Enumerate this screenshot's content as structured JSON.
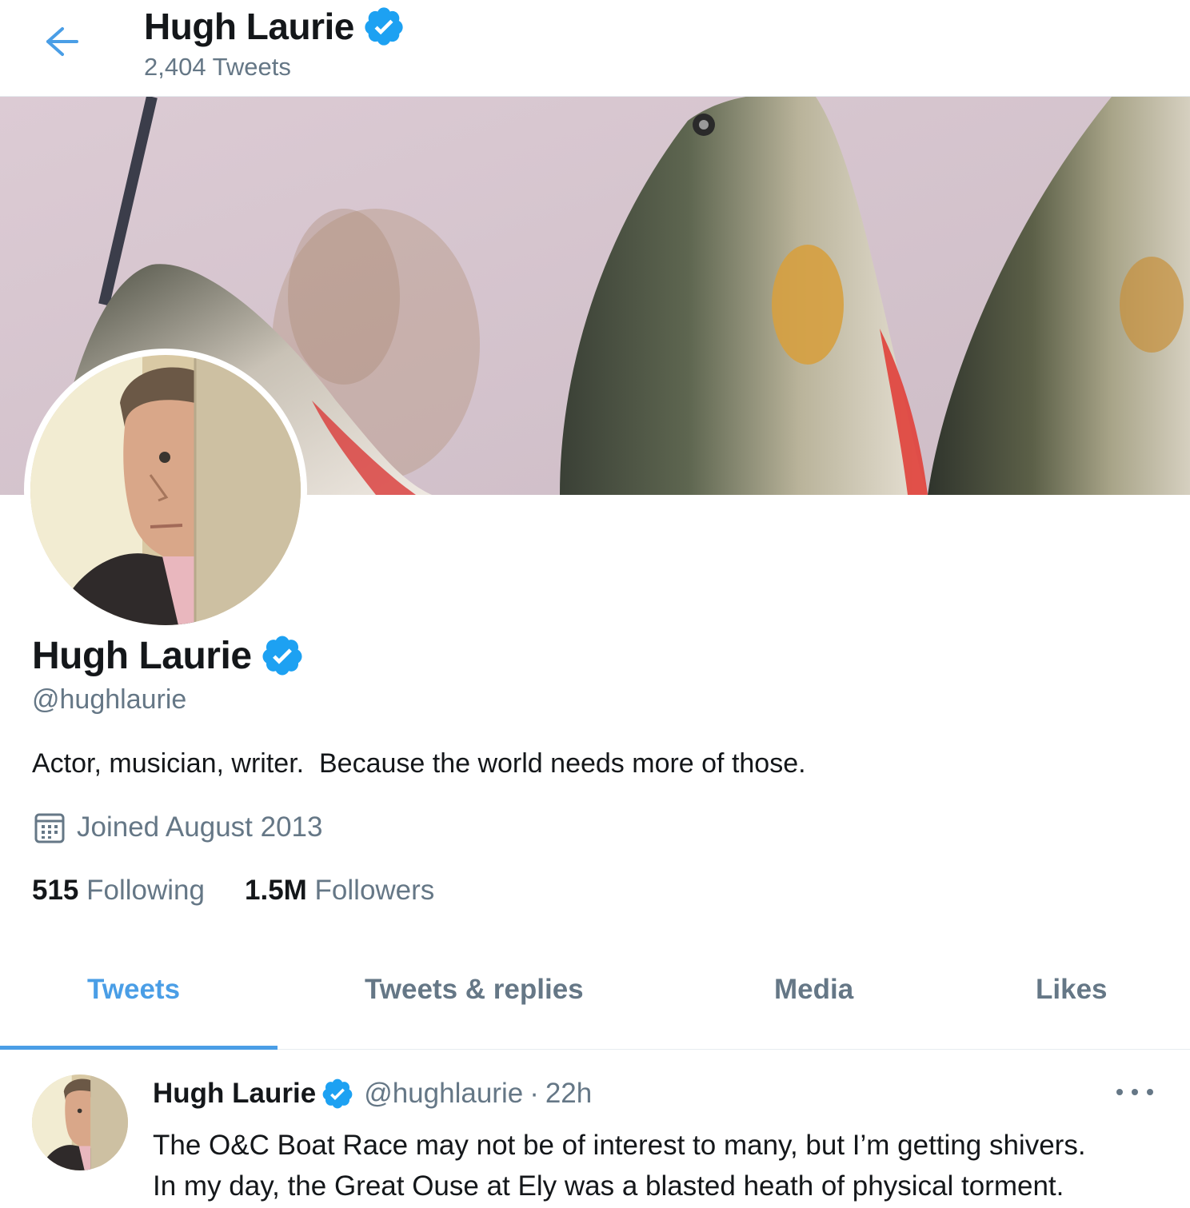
{
  "header": {
    "name": "Hugh Laurie",
    "tweet_count": "2,404 Tweets"
  },
  "profile": {
    "name": "Hugh Laurie",
    "handle": "@hughlaurie",
    "bio": "Actor, musician, writer.  Because the world needs more of those.",
    "joined": "Joined August 2013",
    "following_count": "515",
    "following_label": "Following",
    "followers_count": "1.5M",
    "followers_label": "Followers"
  },
  "tabs": [
    {
      "label": "Tweets",
      "active": true
    },
    {
      "label": "Tweets & replies",
      "active": false
    },
    {
      "label": "Media",
      "active": false
    },
    {
      "label": "Likes",
      "active": false
    }
  ],
  "tweet": {
    "name": "Hugh Laurie",
    "handle": "@hughlaurie",
    "separator": "·",
    "time": "22h",
    "text_line1": "The O&C Boat Race may not be of interest to many, but I’m getting shivers.",
    "text_line2": "In my day, the Great Ouse at Ely was a blasted heath of physical torment."
  },
  "icons": {
    "back": "arrow-left-icon",
    "verified": "verified-badge-icon",
    "calendar": "calendar-icon",
    "more": "more-horizontal-icon"
  },
  "colors": {
    "accent": "#4a9ee6",
    "verified": "#1da1f2",
    "secondary_text": "#657786",
    "primary_text": "#14171a"
  }
}
